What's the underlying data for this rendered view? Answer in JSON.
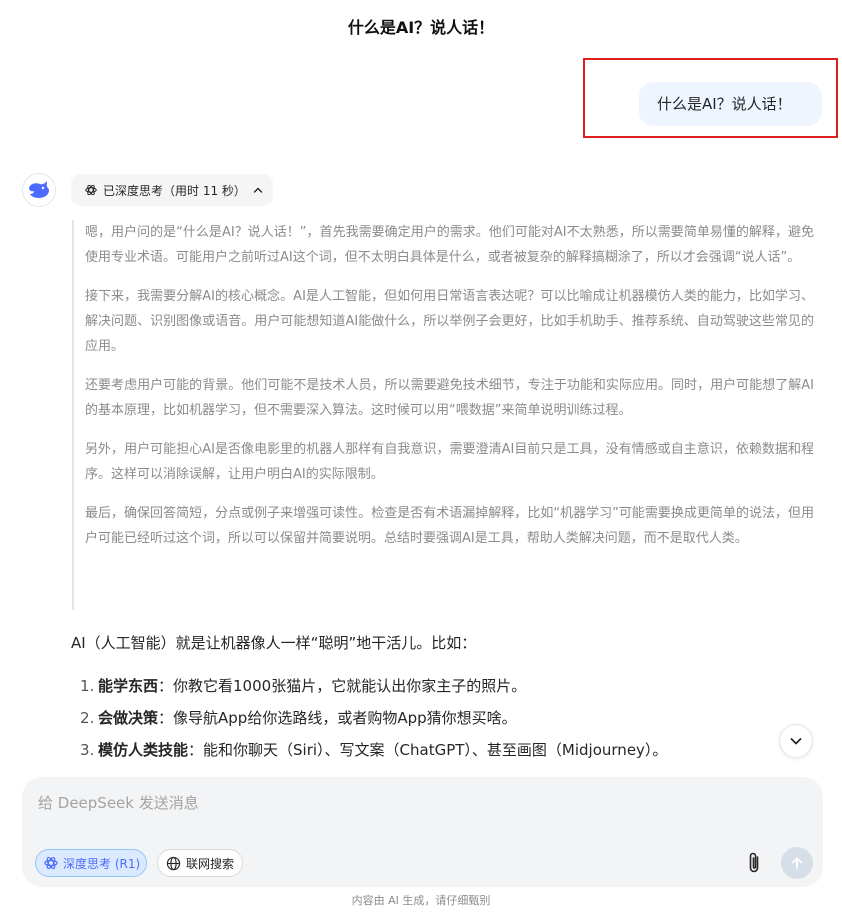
{
  "header": {
    "title": "什么是AI？说人话！"
  },
  "user_message": {
    "text": "什么是AI？说人话！"
  },
  "assistant": {
    "think_toggle_label": "已深度思考（用时 11 秒）",
    "thinking": [
      "嗯，用户问的是“什么是AI？说人话！”，首先我需要确定用户的需求。他们可能对AI不太熟悉，所以需要简单易懂的解释，避免使用专业术语。可能用户之前听过AI这个词，但不太明白具体是什么，或者被复杂的解释搞糊涂了，所以才会强调“说人话”。",
      "接下来，我需要分解AI的核心概念。AI是人工智能，但如何用日常语言表达呢？可以比喻成让机器模仿人类的能力，比如学习、解决问题、识别图像或语音。用户可能想知道AI能做什么，所以举例子会更好，比如手机助手、推荐系统、自动驾驶这些常见的应用。",
      "还要考虑用户可能的背景。他们可能不是技术人员，所以需要避免技术细节，专注于功能和实际应用。同时，用户可能想了解AI的基本原理，比如机器学习，但不需要深入算法。这时候可以用“喂数据”来简单说明训练过程。",
      "另外，用户可能担心AI是否像电影里的机器人那样有自我意识，需要澄清AI目前只是工具，没有情感或自主意识，依赖数据和程序。这样可以消除误解，让用户明白AI的实际限制。",
      "最后，确保回答简短，分点或例子来增强可读性。检查是否有术语漏掉解释，比如“机器学习”可能需要换成更简单的说法，但用户可能已经听过这个词，所以可以保留并简要说明。总结时要强调AI是工具，帮助人类解决问题，而不是取代人类。"
    ],
    "answer_intro": "AI（人工智能）就是让机器像人一样“聪明”地干活儿。比如：",
    "answer_items": [
      {
        "num": "1.",
        "title": "能学东西",
        "text": "：你教它看1000张猫片，它就能认出你家主子的照片。"
      },
      {
        "num": "2.",
        "title": "会做决策",
        "text": "：像导航App给你选路线，或者购物App猜你想买啥。"
      },
      {
        "num": "3.",
        "title": "模仿人类技能",
        "text": "：能和你聊天（Siri）、写文案（ChatGPT）、甚至画图（Midjourney）。"
      }
    ]
  },
  "composer": {
    "placeholder": "给 DeepSeek 发送消息",
    "deep_think_label": "深度思考 (R1)",
    "web_search_label": "联网搜索"
  },
  "footer": {
    "note": "内容由 AI 生成，请仔细甄别"
  },
  "colors": {
    "accent": "#4d6bfe",
    "highlight_box": "#e02020",
    "user_bubble": "#eff5ff"
  }
}
